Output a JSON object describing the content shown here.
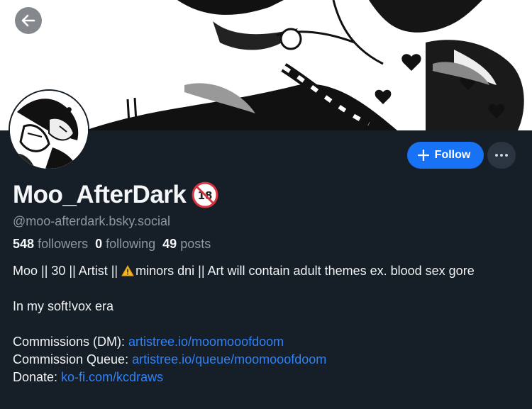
{
  "profile": {
    "display_name": "Moo_AfterDark",
    "age_badge_icon": "no-under-18-icon",
    "handle": "@moo-afterdark.bsky.social",
    "stats": {
      "followers_count": "548",
      "followers_label": "followers",
      "following_count": "0",
      "following_label": "following",
      "posts_count": "49",
      "posts_label": "posts"
    },
    "bio": {
      "line1_before": "Moo || 30 || Artist || ",
      "line1_warning_icon": "warning-icon",
      "line1_after": "minors dni || Art will contain adult themes ex. blood sex gore",
      "line2": "In my soft!vox era",
      "commissions_label": "Commissions (DM): ",
      "commissions_link": "artistree.io/moomooofdoom",
      "queue_label": "Commission Queue: ",
      "queue_link": "artistree.io/queue/moomooofdoom",
      "donate_label": "Donate: ",
      "donate_link": "ko-fi.com/kcdraws"
    }
  },
  "actions": {
    "back_icon": "arrow-left-icon",
    "follow_label": "Follow",
    "follow_icon": "plus-icon",
    "more_icon": "ellipsis-icon"
  },
  "colors": {
    "background": "#161e27",
    "accent": "#1872f5",
    "link": "#2f82f7",
    "muted_text": "#8d98a5"
  }
}
